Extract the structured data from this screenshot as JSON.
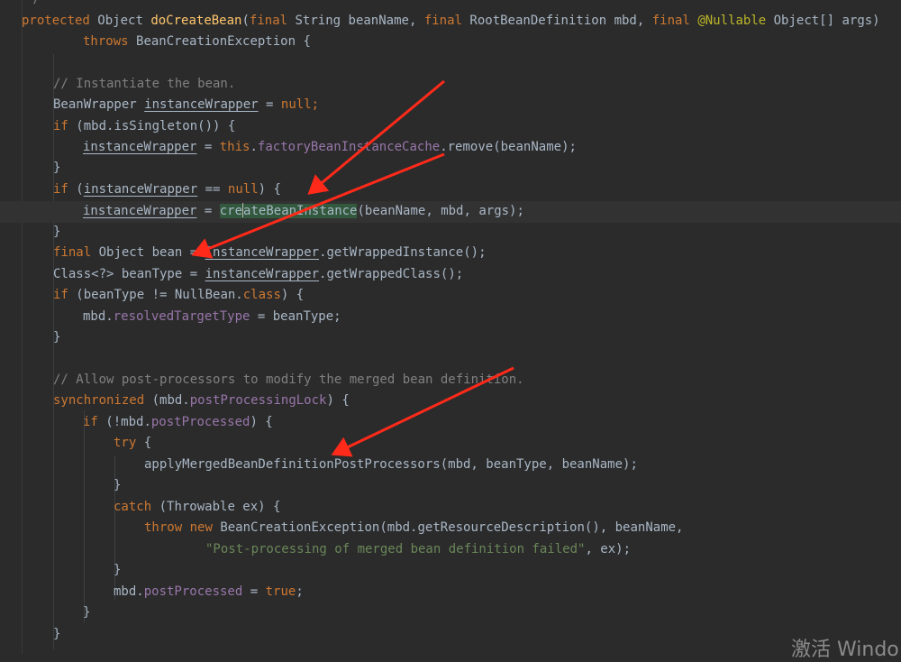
{
  "code": {
    "top_fragment": "*/",
    "signature": {
      "protected": "protected",
      "object_type": "Object",
      "method_name": "doCreateBean",
      "final1": "final",
      "string_type": "String",
      "param_beanName": "beanName,",
      "final2": "final",
      "rbd_type": "RootBeanDefinition",
      "param_mbd": "mbd,",
      "final3": "final",
      "annotation": "@Nullable",
      "param_args": "Object[] args)"
    },
    "throws_kw": "throws",
    "throws_type": "BeanCreationException {",
    "comment1": "// Instantiate the bean.",
    "l4_type": "BeanWrapper",
    "l4_var": "instanceWrapper",
    "l4_eq": "=",
    "l4_null": "null",
    "l4_semi": ";",
    "l5_if": "if",
    "l5_rest": "(mbd.isSingleton()) {",
    "l6_var": "instanceWrapper",
    "l6_eq": "=",
    "l6_this": "this",
    "l6_dot": ".",
    "l6_field": "factoryBeanInstanceCache",
    "l6_rest": ".remove(beanName);",
    "l7_brace": "}",
    "l8_if": "if",
    "l8_paren": "(",
    "l8_var": "instanceWrapper",
    "l8_eq": "==",
    "l8_null": "null",
    "l8_rest": ") {",
    "l9_var": "instanceWrapper",
    "l9_eq": "=",
    "l9_sel1": "cre",
    "l9_sel2": "ateBeanInstance",
    "l9_rest": "(beanName, mbd, args);",
    "l10_brace": "}",
    "l11_final": "final",
    "l11_decl": "Object bean",
    "l11_eq": "=",
    "l11_var": "instanceWrapper",
    "l11_rest": ".getWrappedInstance();",
    "l12_decl": "Class<?> beanType",
    "l12_eq": "=",
    "l12_var": "instanceWrapper",
    "l12_rest": ".getWrappedClass();",
    "l13_if": "if",
    "l13_mid": "(beanType != NullBean.",
    "l13_class": "class",
    "l13_rest": ") {",
    "l14_mbd": "mbd.",
    "l14_field": "resolvedTargetType",
    "l14_rest": "= beanType;",
    "l15_brace": "}",
    "comment2": "// Allow post-processors to modify the merged bean definition.",
    "l17_sync": "synchronized",
    "l17_mid": "(mbd.",
    "l17_field": "postProcessingLock",
    "l17_rest": ") {",
    "l18_if": "if",
    "l18_mid": "(!mbd.",
    "l18_field": "postProcessed",
    "l18_rest": ") {",
    "l19_try": "try",
    "l19_brace": "{",
    "l20_call": "applyMergedBeanDefinitionPostProcessors(mbd, beanType, beanName);",
    "l21_brace": "}",
    "l22_catch": "catch",
    "l22_rest": "(Throwable ex) {",
    "l23_throw": "throw",
    "l23_new": "new",
    "l23_rest": "BeanCreationException(mbd.getResourceDescription(), beanName,",
    "l24_str": "\"Post-processing of merged bean definition failed\"",
    "l24_rest": ", ex);",
    "l25_brace": "}",
    "l26_mbd": "mbd.",
    "l26_field": "postProcessed",
    "l26_eq": "=",
    "l26_true": "true",
    "l26_semi": ";",
    "l27_brace": "}",
    "l28_brace": "}"
  },
  "watermark": "激活 Windo",
  "colors": {
    "background": "#2b2b2b",
    "keyword": "#cc7832",
    "comment": "#808080",
    "method_decl": "#ffc66d",
    "field": "#9876aa",
    "string": "#6a8759",
    "annotation": "#bbb529",
    "arrow": "#ff2a1a"
  }
}
